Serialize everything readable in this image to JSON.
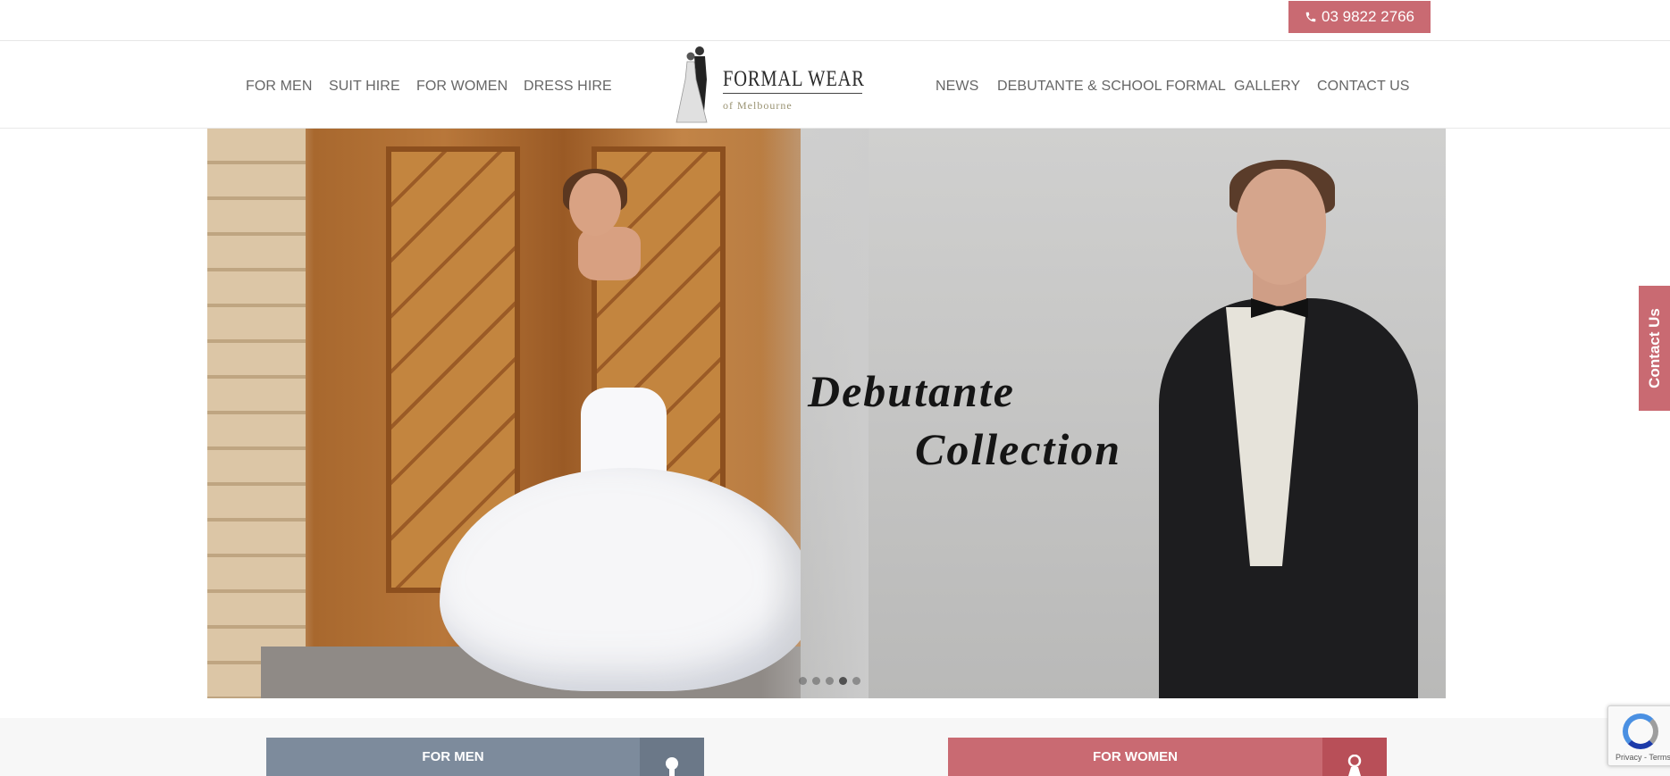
{
  "topbar": {
    "phone": "03 9822 2766"
  },
  "nav": {
    "left": [
      "FOR MEN",
      "SUIT HIRE",
      "FOR WOMEN",
      "DRESS HIRE"
    ],
    "right": [
      "NEWS",
      "DEBUTANTE & SCHOOL FORMAL",
      "GALLERY",
      "CONTACT US"
    ]
  },
  "logo": {
    "title": "FORMAL WEAR",
    "subtitle": "of Melbourne"
  },
  "hero": {
    "line1": "Debutante",
    "line2": "Collection",
    "slide_count": 5,
    "active_slide": 4
  },
  "side_tab": {
    "label": "Contact Us"
  },
  "categories": {
    "men": {
      "label": "FOR MEN",
      "color": "#7d8b9c",
      "icon_bg": "#6b7888"
    },
    "women": {
      "label": "FOR WOMEN",
      "color": "#c96a72",
      "icon_bg": "#b84f58"
    }
  },
  "recaptcha": {
    "text": "Privacy - Terms"
  },
  "colors": {
    "accent": "#c96a72",
    "nav_text": "#666666"
  }
}
